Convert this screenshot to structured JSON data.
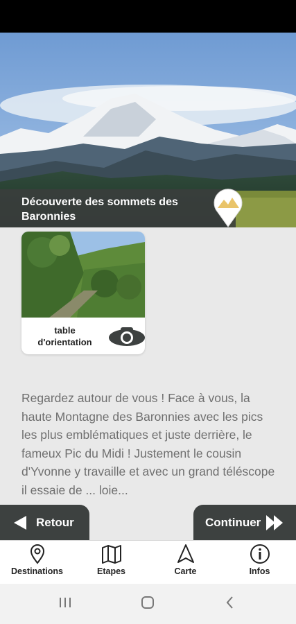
{
  "header": {
    "title": "Découverte des sommets des Baronnies"
  },
  "cards": [
    {
      "label": "table d'orientation",
      "icon": "camera-icon"
    }
  ],
  "body_text": "Regardez autour de vous ! Face à vous, la haute Montagne des Baronnies avec les pics les plus emblématiques et juste derrière, le fameux Pic du Midi ! Justement le cousin d'Yvonne y travaille et avec un grand téléscope il essaie de ... loie...",
  "nav_buttons": {
    "back": "Retour",
    "next": "Continuer"
  },
  "tabs": [
    {
      "label": "Destinations",
      "icon": "map-pin-icon"
    },
    {
      "label": "Etapes",
      "icon": "map-icon"
    },
    {
      "label": "Carte",
      "icon": "navigation-arrow-icon"
    },
    {
      "label": "Infos",
      "icon": "info-icon"
    }
  ],
  "colors": {
    "dark_panel": "#3d4140",
    "background": "#e9e9e9",
    "text_grey": "#6f6f6f",
    "pin_gold": "#e9c46a"
  }
}
